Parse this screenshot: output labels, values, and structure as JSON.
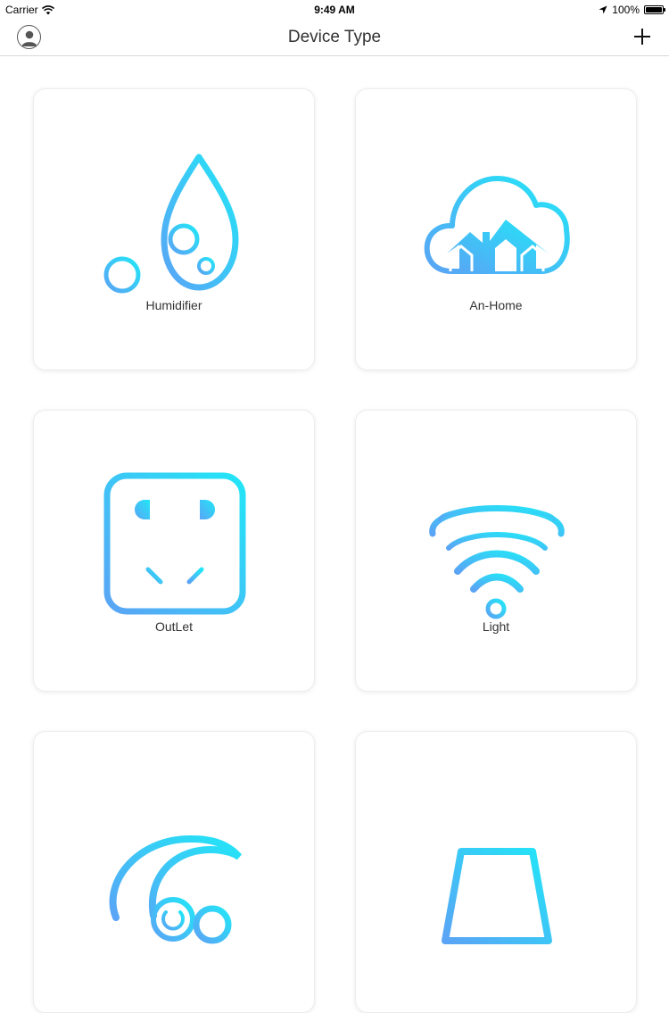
{
  "status_bar": {
    "carrier": "Carrier",
    "time": "9:49 AM",
    "battery": "100%"
  },
  "nav": {
    "title": "Device Type",
    "left_icon": "user-profile-icon",
    "right_icon": "plus-icon"
  },
  "devices": [
    {
      "label": "Humidifier",
      "icon": "water-drop-icon"
    },
    {
      "label": "An-Home",
      "icon": "cloud-home-icon"
    },
    {
      "label": "OutLet",
      "icon": "power-outlet-icon"
    },
    {
      "label": "Light",
      "icon": "light-wave-icon"
    },
    {
      "label": "",
      "icon": "fan-power-icon"
    },
    {
      "label": "",
      "icon": "lamp-icon"
    }
  ],
  "colors": {
    "gradient_start": "#5aa4f5",
    "gradient_end": "#22e6f7",
    "nav_divider": "#d9d9d9"
  }
}
